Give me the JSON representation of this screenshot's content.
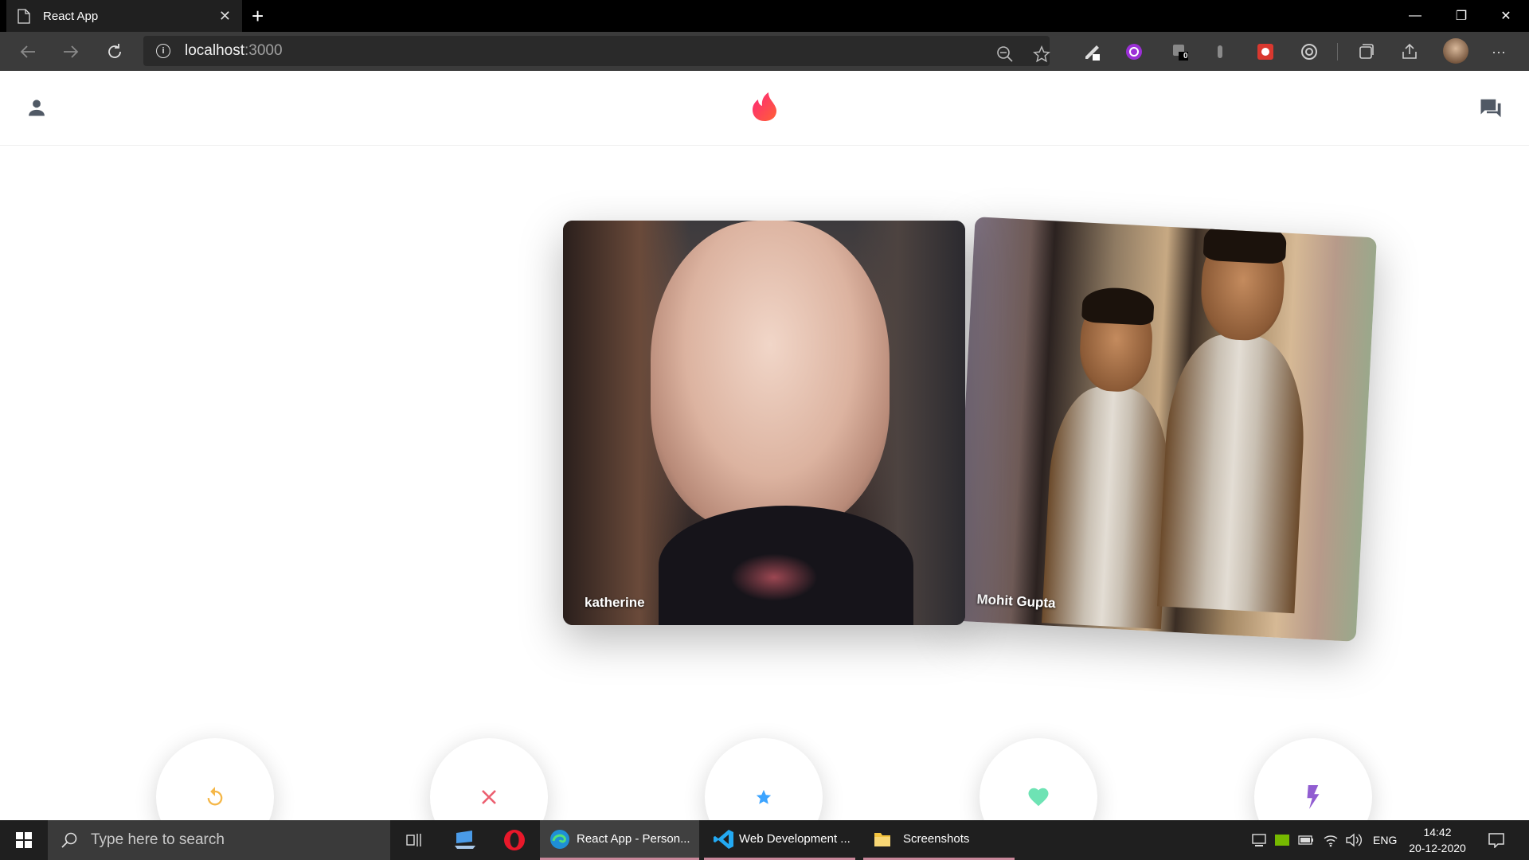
{
  "browser": {
    "tab_title": "React App",
    "tab_close": "✕",
    "new_tab": "+",
    "url_host": "localhost",
    "url_port": ":3000",
    "extension_badge": "0",
    "more_menu": "···",
    "window_controls": {
      "minimize": "—",
      "restore": "❐",
      "close": "✕"
    }
  },
  "app": {
    "cards": [
      {
        "name": "katherine"
      },
      {
        "name": "Mohit Gupta"
      }
    ],
    "colors": {
      "brand": "#fe3c72",
      "undo": "#f5b748",
      "nope": "#ec5e6f",
      "superlike": "#3ca4ff",
      "like": "#6ee3b4",
      "boost": "#915dd1",
      "header_icon": "#505965"
    },
    "buttons": [
      {
        "name": "undo",
        "icon": "replay-icon"
      },
      {
        "name": "nope",
        "icon": "close-icon"
      },
      {
        "name": "superlike",
        "icon": "star-icon"
      },
      {
        "name": "like",
        "icon": "heart-icon"
      },
      {
        "name": "boost",
        "icon": "flash-icon"
      }
    ]
  },
  "taskbar": {
    "search_placeholder": "Type here to search",
    "apps": [
      {
        "label": "React App - Person...",
        "icon": "edge-icon"
      },
      {
        "label": "Web Development ...",
        "icon": "vscode-icon"
      },
      {
        "label": "Screenshots",
        "icon": "folder-icon"
      }
    ],
    "language": "ENG",
    "time": "14:42",
    "date": "20-12-2020"
  }
}
